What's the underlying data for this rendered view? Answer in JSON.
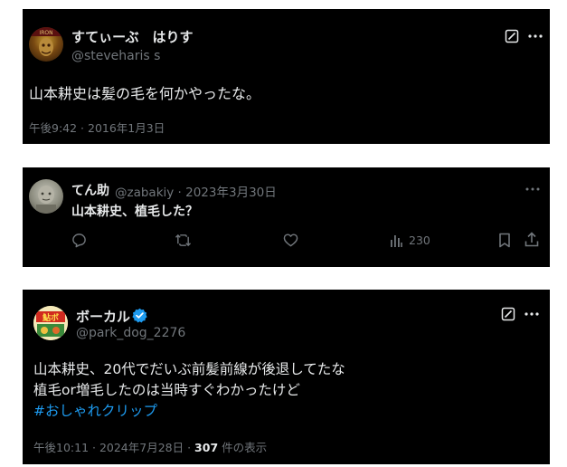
{
  "tweet1": {
    "display_name": "すてぃーぶ　はりす",
    "handle": "@steveharis s",
    "text": "山本耕史は髪の毛を何かやったな。",
    "timestamp": "午後9:42 · 2016年1月3日"
  },
  "tweet2": {
    "display_name": "てん助",
    "handle_date": "@zabakiy · 2023年3月30日",
    "text": "山本耕史、植毛した？",
    "views": "230"
  },
  "tweet3": {
    "display_name": "ボーカル",
    "handle": "@park_dog_2276",
    "line1": "山本耕史、20代でだいぶ前髪前線が後退してたな",
    "line2": "植毛or増毛したのは当時すぐわかったけど",
    "hashtag": "#おしゃれクリップ",
    "timestamp": "午後10:11 · 2024年7月28日 · ",
    "view_count": "307",
    "view_label": " 件の表示"
  },
  "colors": {
    "background": "#000000",
    "text_primary": "#e7e9ea",
    "text_secondary": "#71767b",
    "link": "#1d9bf0",
    "verified": "#1d9bf0"
  },
  "icons": [
    "grok-icon",
    "more-icon",
    "reply-icon",
    "retweet-icon",
    "like-icon",
    "views-icon",
    "bookmark-icon",
    "share-icon",
    "verified-badge-icon"
  ]
}
